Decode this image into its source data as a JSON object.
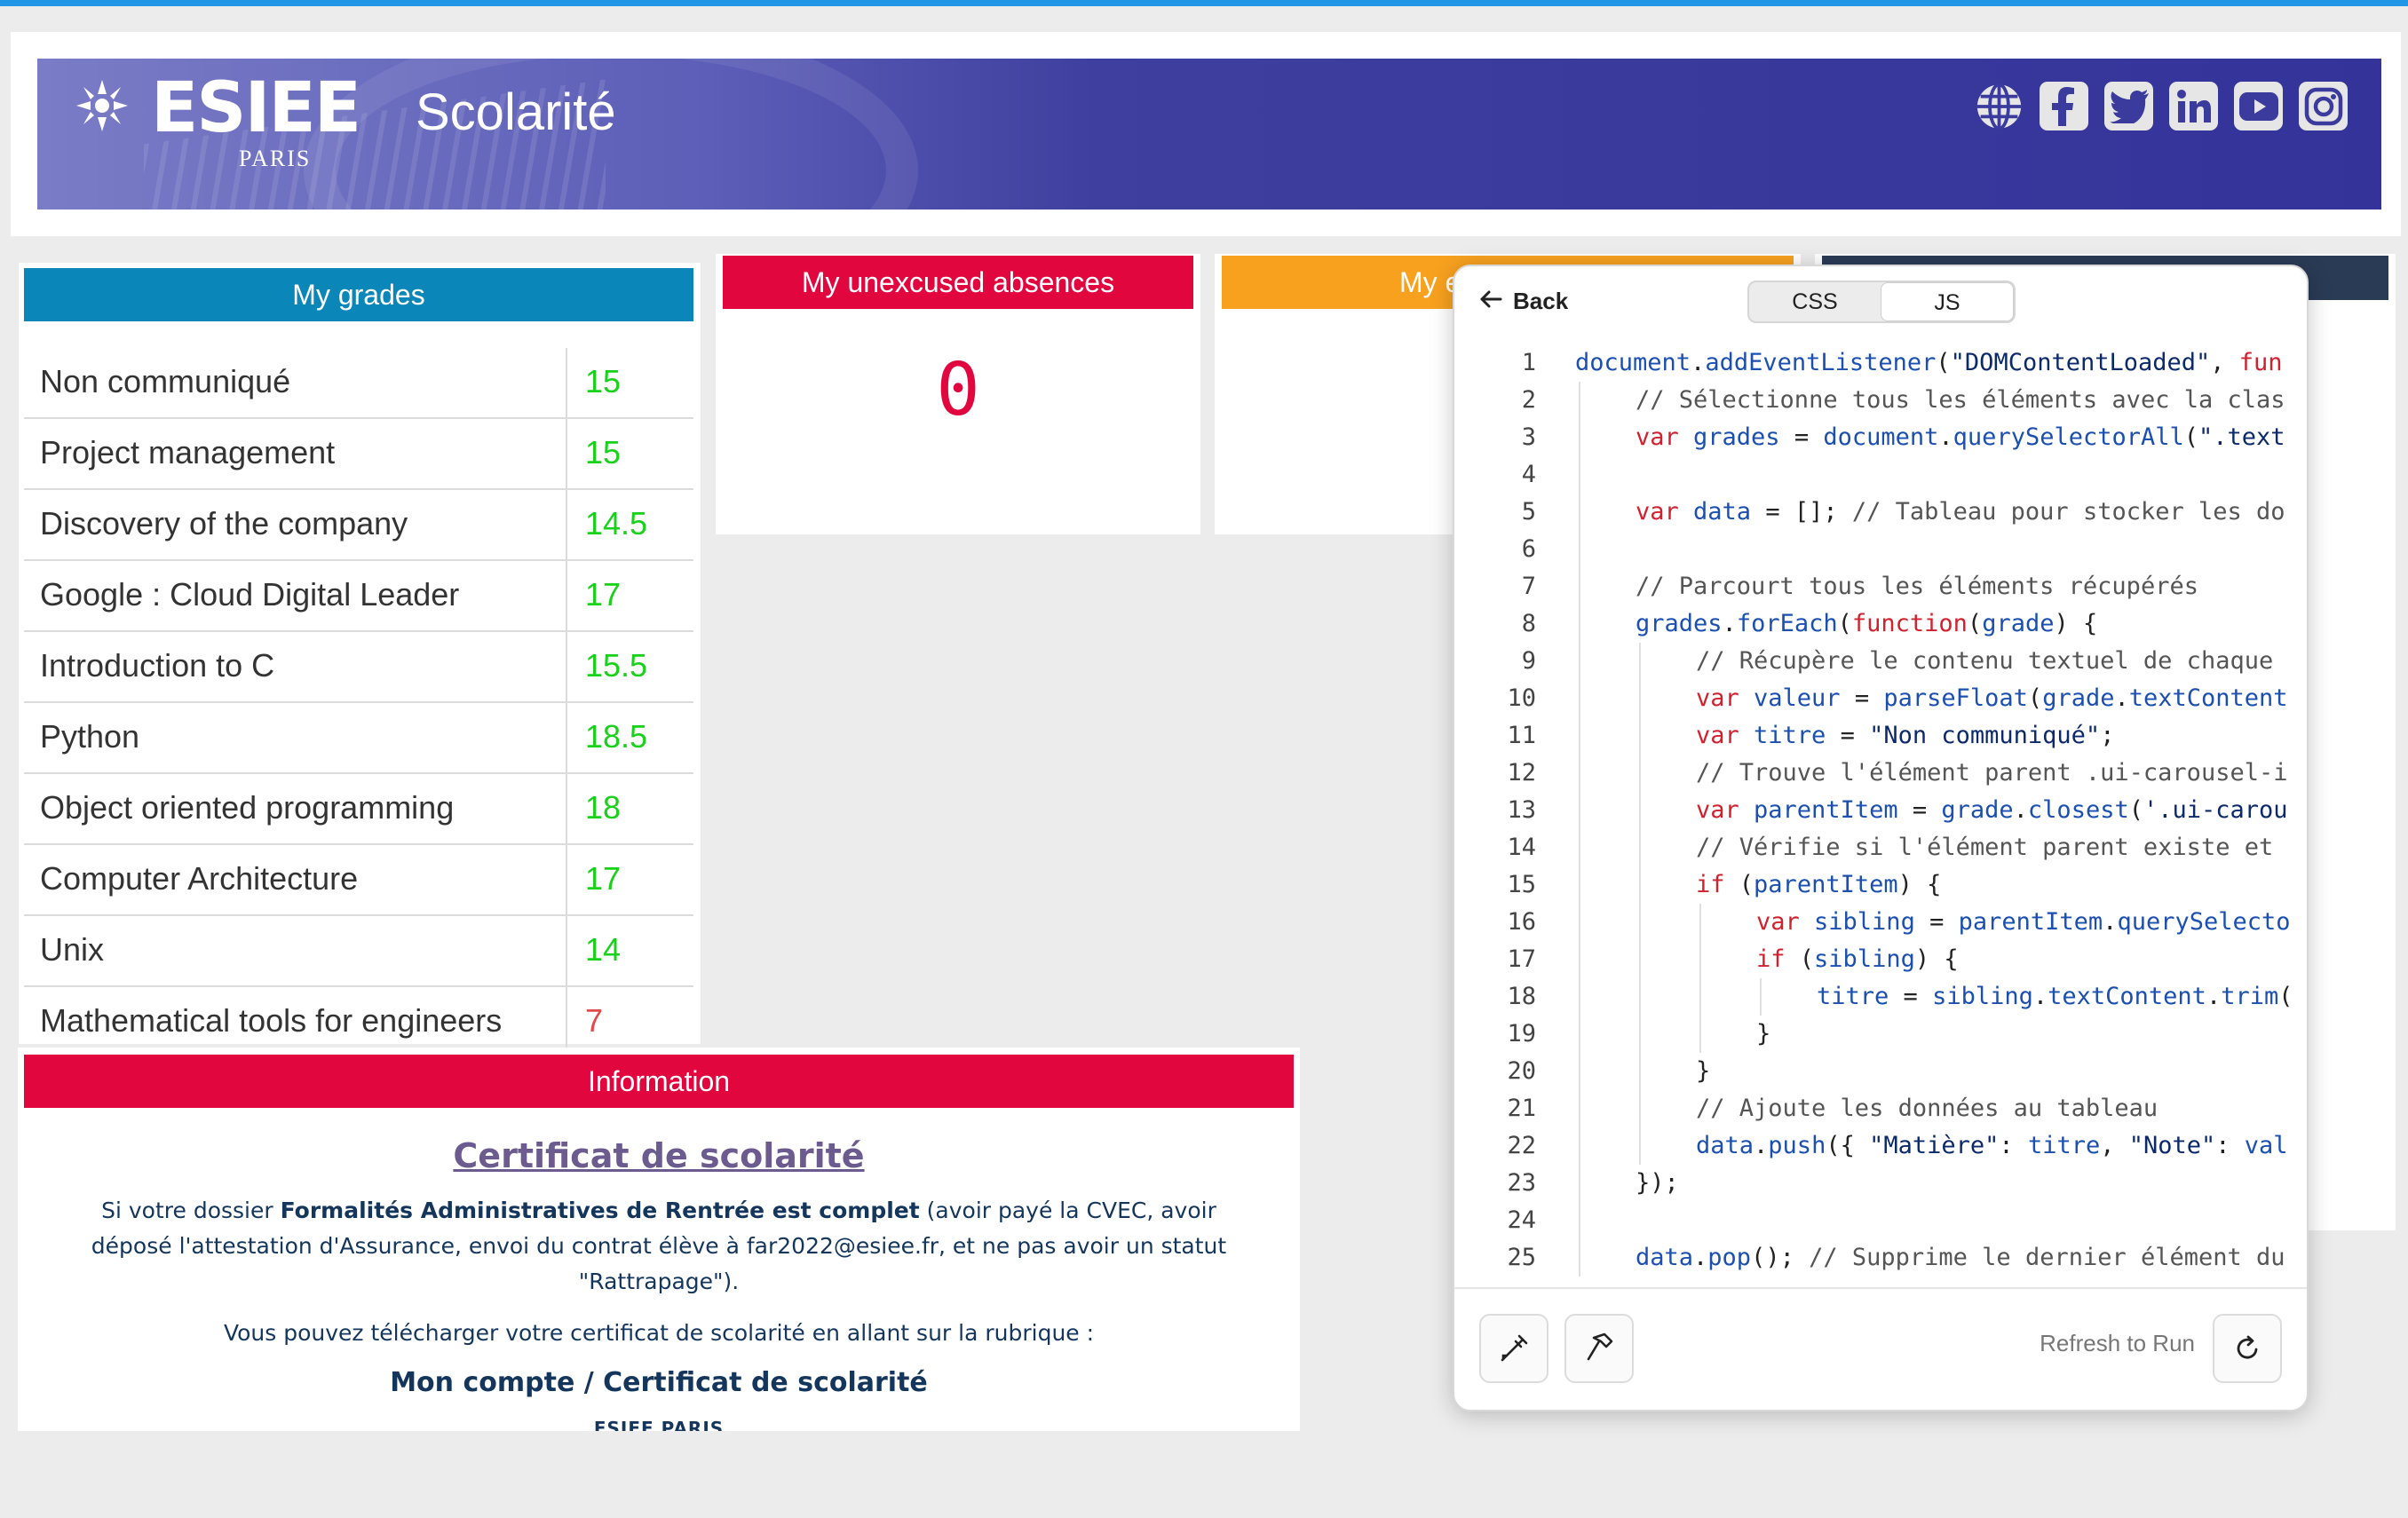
{
  "header": {
    "logo_name": "ESIEE",
    "logo_sub": "PARIS",
    "title": "Scolarité",
    "socials": [
      "globe-icon",
      "facebook-icon",
      "twitter-icon",
      "linkedin-icon",
      "youtube-icon",
      "instagram-icon"
    ]
  },
  "grades": {
    "title": "My grades",
    "rows": [
      {
        "name": "Non communiqué",
        "value": "15",
        "color": "#19d119"
      },
      {
        "name": "Project management",
        "value": "15",
        "color": "#19d119"
      },
      {
        "name": "Discovery of the company",
        "value": "14.5",
        "color": "#19d119"
      },
      {
        "name": "Google : Cloud Digital Leader",
        "value": "17",
        "color": "#19d119"
      },
      {
        "name": "Introduction to C",
        "value": "15.5",
        "color": "#19d119"
      },
      {
        "name": "Python",
        "value": "18.5",
        "color": "#19d119"
      },
      {
        "name": "Object oriented programming",
        "value": "18",
        "color": "#19d119"
      },
      {
        "name": "Computer Architecture",
        "value": "17",
        "color": "#19d119"
      },
      {
        "name": "Unix",
        "value": "14",
        "color": "#19d119"
      },
      {
        "name": "Mathematical tools for engineers",
        "value": "7",
        "color": "#e24a4a"
      }
    ]
  },
  "absences": {
    "title": "My unexcused absences",
    "count": "0"
  },
  "third_card": {
    "title_visible": "My e"
  },
  "info": {
    "title": "Information",
    "cert_title": "Certificat de scolarité",
    "p1_pre": "Si votre dossier ",
    "p1_bold": "Formalités Administratives de Rentrée est complet",
    "p1_post": " (avoir payé la CVEC, avoir déposé l'attestation d'Assurance, envoi du contrat élève à far2022@esiee.fr, et ne pas avoir un statut \"Rattrapage\").",
    "p2": "Vous pouvez télécharger votre certificat de scolarité en allant sur la rubrique :",
    "menu_path": "Mon compte / Certificat de scolarité",
    "org": "ESIEE PARIS"
  },
  "editor": {
    "back_label": "Back",
    "tabs": [
      "CSS",
      "JS"
    ],
    "active_tab": "JS",
    "refresh_label": "Refresh to Run",
    "lines": [
      {
        "n": "1",
        "indent": 0,
        "parts": [
          [
            "id",
            "document"
          ],
          [
            "plain",
            "."
          ],
          [
            "id",
            "addEventListener"
          ],
          [
            "plain",
            "("
          ],
          [
            "str",
            "\"DOMContentLoaded\""
          ],
          [
            "plain",
            ", "
          ],
          [
            "kw",
            "fun"
          ]
        ]
      },
      {
        "n": "2",
        "indent": 1,
        "parts": [
          [
            "com",
            "// Sélectionne tous les éléments avec la clas"
          ]
        ]
      },
      {
        "n": "3",
        "indent": 1,
        "parts": [
          [
            "kw",
            "var "
          ],
          [
            "id",
            "grades"
          ],
          [
            "plain",
            " = "
          ],
          [
            "id",
            "document"
          ],
          [
            "plain",
            "."
          ],
          [
            "id",
            "querySelectorAll"
          ],
          [
            "plain",
            "("
          ],
          [
            "str",
            "\".text"
          ]
        ]
      },
      {
        "n": "4",
        "indent": 1,
        "parts": []
      },
      {
        "n": "5",
        "indent": 1,
        "parts": [
          [
            "kw",
            "var "
          ],
          [
            "id",
            "data"
          ],
          [
            "plain",
            " = []; "
          ],
          [
            "com",
            "// Tableau pour stocker les do"
          ]
        ]
      },
      {
        "n": "6",
        "indent": 1,
        "parts": []
      },
      {
        "n": "7",
        "indent": 1,
        "parts": [
          [
            "com",
            "// Parcourt tous les éléments récupérés"
          ]
        ]
      },
      {
        "n": "8",
        "indent": 1,
        "parts": [
          [
            "id",
            "grades"
          ],
          [
            "plain",
            "."
          ],
          [
            "id",
            "forEach"
          ],
          [
            "plain",
            "("
          ],
          [
            "kw",
            "function"
          ],
          [
            "plain",
            "("
          ],
          [
            "id",
            "grade"
          ],
          [
            "plain",
            ") {"
          ]
        ]
      },
      {
        "n": "9",
        "indent": 2,
        "parts": [
          [
            "com",
            "// Récupère le contenu textuel de chaque"
          ]
        ]
      },
      {
        "n": "10",
        "indent": 2,
        "parts": [
          [
            "kw",
            "var "
          ],
          [
            "id",
            "valeur"
          ],
          [
            "plain",
            " = "
          ],
          [
            "id",
            "parseFloat"
          ],
          [
            "plain",
            "("
          ],
          [
            "id",
            "grade"
          ],
          [
            "plain",
            "."
          ],
          [
            "id",
            "textContent"
          ]
        ]
      },
      {
        "n": "11",
        "indent": 2,
        "parts": [
          [
            "kw",
            "var "
          ],
          [
            "id",
            "titre"
          ],
          [
            "plain",
            " = "
          ],
          [
            "str",
            "\"Non communiqué\""
          ],
          [
            "plain",
            ";"
          ]
        ]
      },
      {
        "n": "12",
        "indent": 2,
        "parts": [
          [
            "com",
            "// Trouve l'élément parent .ui-carousel-i"
          ]
        ]
      },
      {
        "n": "13",
        "indent": 2,
        "parts": [
          [
            "kw",
            "var "
          ],
          [
            "id",
            "parentItem"
          ],
          [
            "plain",
            " = "
          ],
          [
            "id",
            "grade"
          ],
          [
            "plain",
            "."
          ],
          [
            "id",
            "closest"
          ],
          [
            "plain",
            "("
          ],
          [
            "str",
            "'.ui-carou"
          ]
        ]
      },
      {
        "n": "14",
        "indent": 2,
        "parts": [
          [
            "com",
            "// Vérifie si l'élément parent existe et"
          ]
        ]
      },
      {
        "n": "15",
        "indent": 2,
        "parts": [
          [
            "kw",
            "if "
          ],
          [
            "plain",
            "("
          ],
          [
            "id",
            "parentItem"
          ],
          [
            "plain",
            ") {"
          ]
        ]
      },
      {
        "n": "16",
        "indent": 3,
        "parts": [
          [
            "kw",
            "var "
          ],
          [
            "id",
            "sibling"
          ],
          [
            "plain",
            " = "
          ],
          [
            "id",
            "parentItem"
          ],
          [
            "plain",
            "."
          ],
          [
            "id",
            "querySelecto"
          ]
        ]
      },
      {
        "n": "17",
        "indent": 3,
        "parts": [
          [
            "kw",
            "if "
          ],
          [
            "plain",
            "("
          ],
          [
            "id",
            "sibling"
          ],
          [
            "plain",
            ") {"
          ]
        ]
      },
      {
        "n": "18",
        "indent": 4,
        "parts": [
          [
            "id",
            "titre"
          ],
          [
            "plain",
            " = "
          ],
          [
            "id",
            "sibling"
          ],
          [
            "plain",
            "."
          ],
          [
            "id",
            "textContent"
          ],
          [
            "plain",
            "."
          ],
          [
            "id",
            "trim"
          ],
          [
            "plain",
            "("
          ]
        ]
      },
      {
        "n": "19",
        "indent": 3,
        "parts": [
          [
            "plain",
            "}"
          ]
        ]
      },
      {
        "n": "20",
        "indent": 2,
        "parts": [
          [
            "plain",
            "}"
          ]
        ]
      },
      {
        "n": "21",
        "indent": 2,
        "parts": [
          [
            "com",
            "// Ajoute les données au tableau"
          ]
        ]
      },
      {
        "n": "22",
        "indent": 2,
        "parts": [
          [
            "id",
            "data"
          ],
          [
            "plain",
            "."
          ],
          [
            "id",
            "push"
          ],
          [
            "plain",
            "({ "
          ],
          [
            "str",
            "\"Matière\""
          ],
          [
            "plain",
            ": "
          ],
          [
            "id",
            "titre"
          ],
          [
            "plain",
            ", "
          ],
          [
            "str",
            "\"Note\""
          ],
          [
            "plain",
            ": "
          ],
          [
            "id",
            "val"
          ]
        ]
      },
      {
        "n": "23",
        "indent": 1,
        "parts": [
          [
            "plain",
            "});"
          ]
        ]
      },
      {
        "n": "24",
        "indent": 1,
        "parts": []
      },
      {
        "n": "25",
        "indent": 1,
        "parts": [
          [
            "id",
            "data"
          ],
          [
            "plain",
            "."
          ],
          [
            "id",
            "pop"
          ],
          [
            "plain",
            "(); "
          ],
          [
            "com",
            "// Supprime le dernier élément du"
          ]
        ]
      }
    ]
  }
}
